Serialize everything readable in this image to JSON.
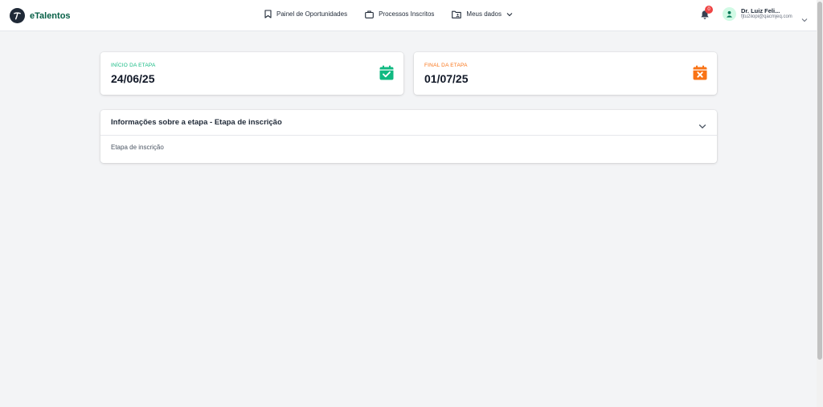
{
  "brand": {
    "name": "eTalentos",
    "logo_letter": "T"
  },
  "nav": {
    "items": [
      {
        "label": "Painel de Oportunidades",
        "icon": "bookmark-icon"
      },
      {
        "label": "Processos Inscritos",
        "icon": "briefcase-icon"
      },
      {
        "label": "Meus dados",
        "icon": "folder-user-icon"
      }
    ]
  },
  "notifications": {
    "count": "0"
  },
  "user": {
    "name": "Dr. Luiz Feli...",
    "email": "fjtu2iiopi@qacmjeq.com"
  },
  "stage": {
    "start": {
      "label": "INÍCIO DA ETAPA",
      "date": "24/06/25",
      "icon": "calendar-check-icon",
      "color": "#10b981"
    },
    "end": {
      "label": "FINAL DA ETAPA",
      "date": "01/07/25",
      "icon": "calendar-x-icon",
      "color": "#f97316"
    }
  },
  "info": {
    "title": "Informações sobre a etapa - Etapa de inscrição",
    "body": "Etapa de inscrição"
  },
  "colors": {
    "brand": "#065f46",
    "accent_green": "#10b981",
    "accent_orange": "#f97316",
    "badge": "#ef4444"
  }
}
